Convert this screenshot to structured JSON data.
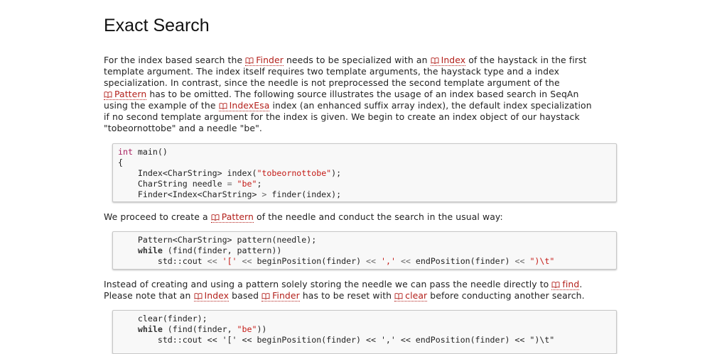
{
  "heading": "Exact Search",
  "para1": {
    "l1": {
      "a": "For the index based search the ",
      "ref1": "Finder",
      "b": " needs to be specialized with an ",
      "ref2": "Index",
      "c": " of the haystack in the first"
    },
    "l2": "template argument. The index itself requires two template arguments, the haystack type and a index",
    "l3": "specialization. In contrast, since the needle is not preprocessed the second template argument of the",
    "l4": {
      "ref": "Pattern",
      "a": " has to be omitted. The following source illustrates the usage of an index based search in SeqAn"
    },
    "l5": {
      "a": "using the example of the ",
      "ref": "IndexEsa",
      "b": " index (an enhanced suffix array index), the default index specialization"
    },
    "l6": "if no second template argument for the index is given. We begin to create an index object of our haystack",
    "l7": "\"tobeornottobe\" and a needle \"be\"."
  },
  "code1": {
    "l1_kw": "int",
    "l1_rest": " main()",
    "l2": "{",
    "l3_a": "    Index<CharString> index(",
    "l3_s": "\"tobeornottobe\"",
    "l3_b": ");",
    "l4_a": "    CharString needle ",
    "l4_op": "=",
    "l4_sp": " ",
    "l4_s": "\"be\"",
    "l4_b": ";",
    "l5_a": "    Finder<Index<CharString> ",
    "l5_op": ">",
    "l5_b": " finder(index);"
  },
  "para2": {
    "a": "We proceed to create a ",
    "ref": "Pattern",
    "b": " of the needle and conduct the search in the usual way:"
  },
  "code2": {
    "l1": "    Pattern<CharString> pattern(needle);",
    "l2_kw": "    while",
    "l2_rest": " (find(finder, pattern))",
    "l3_a": "        std::cout ",
    "l3_op1": "<<",
    "l3_sp1": " ",
    "l3_s1": "'['",
    "l3_sp2": " ",
    "l3_op2": "<<",
    "l3_b": " beginPosition(finder) ",
    "l3_op3": "<<",
    "l3_sp3": " ",
    "l3_s2": "','",
    "l3_sp4": " ",
    "l3_op4": "<<",
    "l3_c": " endPosition(finder) ",
    "l3_op5": "<<",
    "l3_sp5": " ",
    "l3_s3": "\")\\t\""
  },
  "para3": {
    "l1": {
      "a": "Instead of creating and using a pattern solely storing the needle we can pass the needle directly to ",
      "ref": "find",
      "b": "."
    },
    "l2": {
      "a": "Please note that an ",
      "ref1": "Index",
      "b": " based ",
      "ref2": "Finder",
      "c": " has to be reset with ",
      "ref3": "clear",
      "d": " before conducting another search."
    }
  },
  "code3": {
    "l1": "    clear(finder);",
    "l2_kw": "    while",
    "l2_a": " (find(finder, ",
    "l2_s": "\"be\"",
    "l2_b": "))",
    "l3": "        std::cout << '[' << beginPosition(finder) << ',' << endPosition(finder) << \")\\t\""
  }
}
